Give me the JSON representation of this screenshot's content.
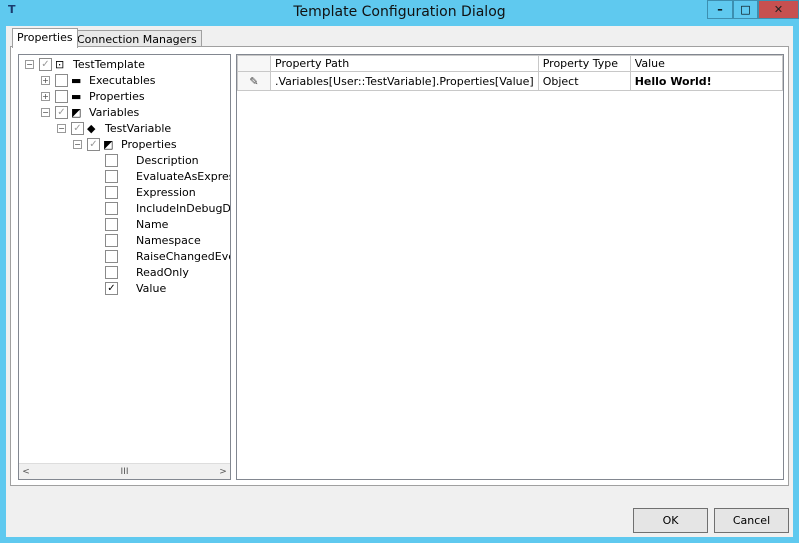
{
  "window": {
    "title": "Template Configuration Dialog",
    "icon": "T",
    "minimize": "–",
    "maximize": "□",
    "close": "✕"
  },
  "tabs": [
    {
      "label": "Properties"
    },
    {
      "label": "Connection Managers"
    }
  ],
  "tree": [
    {
      "label": "TestTemplate",
      "expander": "−",
      "checked": true,
      "icon": "template-icon"
    },
    {
      "label": "Executables",
      "expander": "+",
      "checked": false,
      "icon": "folder-icon"
    },
    {
      "label": "Properties",
      "expander": "+",
      "checked": false,
      "icon": "folder-icon"
    },
    {
      "label": "Variables",
      "expander": "−",
      "checked": true,
      "icon": "folder-open-icon"
    },
    {
      "label": "TestVariable",
      "expander": "−",
      "checked": true,
      "icon": "variable-icon"
    },
    {
      "label": "Properties",
      "expander": "−",
      "checked": true,
      "icon": "folder-open-icon"
    },
    {
      "label": "Description",
      "checked": false
    },
    {
      "label": "EvaluateAsExpression",
      "checked": false
    },
    {
      "label": "Expression",
      "checked": false
    },
    {
      "label": "IncludeInDebugDump",
      "checked": false
    },
    {
      "label": "Name",
      "checked": false
    },
    {
      "label": "Namespace",
      "checked": false
    },
    {
      "label": "RaiseChangedEvent",
      "checked": false
    },
    {
      "label": "ReadOnly",
      "checked": false
    },
    {
      "label": "Value",
      "checked": true
    }
  ],
  "scroll": {
    "left": "<",
    "thumb": "III",
    "right": ">"
  },
  "grid": {
    "columns": [
      "Property Path",
      "Property Type",
      "Value"
    ],
    "rows": [
      {
        "marker": "✎",
        "path": ".Variables[User::TestVariable].Properties[Value]",
        "type": "Object",
        "value": "Hello World!"
      }
    ]
  },
  "buttons": {
    "ok": "OK",
    "cancel": "Cancel"
  }
}
